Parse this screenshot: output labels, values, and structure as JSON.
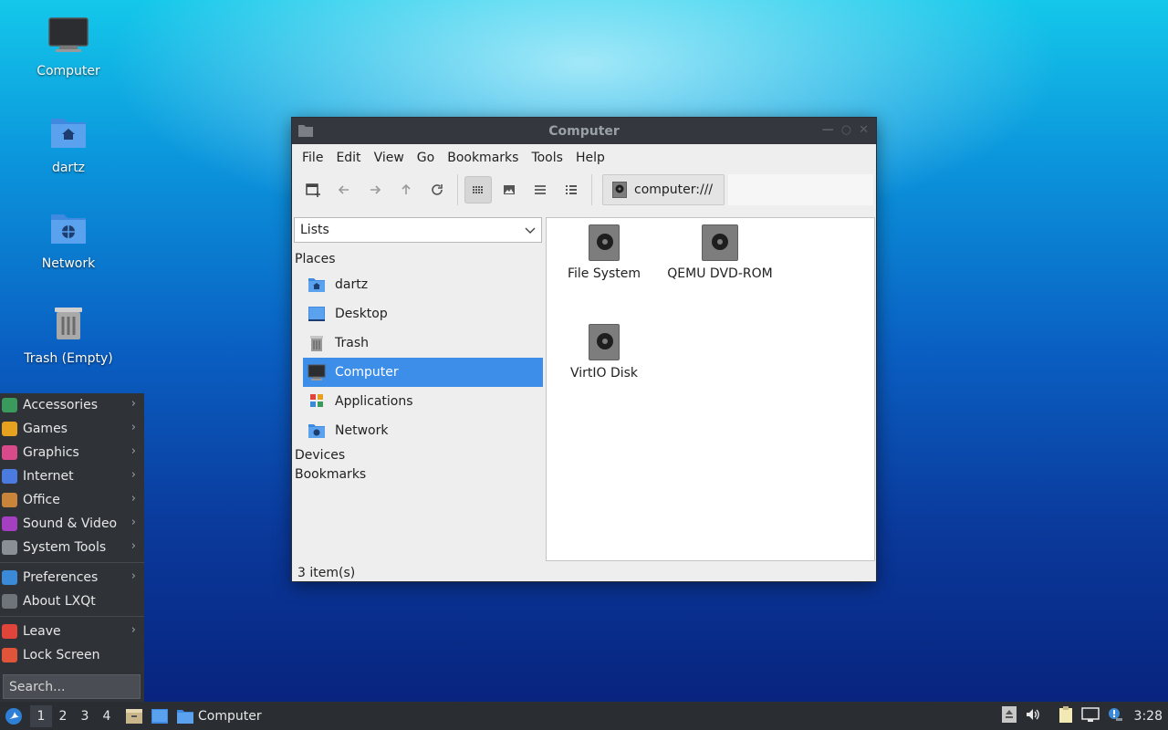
{
  "desktop": {
    "icons": [
      {
        "label": "Computer",
        "icon": "monitor-icon"
      },
      {
        "label": "dartz",
        "icon": "home-folder-icon"
      },
      {
        "label": "Network",
        "icon": "network-folder-icon"
      },
      {
        "label": "Trash (Empty)",
        "icon": "trash-icon"
      }
    ]
  },
  "window": {
    "title": "Computer",
    "menu": [
      "File",
      "Edit",
      "View",
      "Go",
      "Bookmarks",
      "Tools",
      "Help"
    ],
    "address": "computer:///",
    "side": {
      "combo_value": "Lists",
      "places_header": "Places",
      "places": [
        "dartz",
        "Desktop",
        "Trash",
        "Computer",
        "Applications",
        "Network"
      ],
      "selected": "Computer",
      "devices_header": "Devices",
      "bookmarks_header": "Bookmarks"
    },
    "items": [
      "File System",
      "QEMU DVD-ROM",
      "VirtIO Disk"
    ],
    "status": "3 item(s)"
  },
  "appmenu": {
    "groups": [
      [
        {
          "label": "Accessories",
          "color": "#3a9a5c",
          "submenu": true
        },
        {
          "label": "Games",
          "color": "#e6a11e",
          "submenu": true
        },
        {
          "label": "Graphics",
          "color": "#d94a8a",
          "submenu": true
        },
        {
          "label": "Internet",
          "color": "#4c7be0",
          "submenu": true
        },
        {
          "label": "Office",
          "color": "#c8843a",
          "submenu": true
        },
        {
          "label": "Sound & Video",
          "color": "#a43fc2",
          "submenu": true
        },
        {
          "label": "System Tools",
          "color": "#8a8f96",
          "submenu": true
        }
      ],
      [
        {
          "label": "Preferences",
          "color": "#3a8ad8",
          "submenu": true
        },
        {
          "label": "About LXQt",
          "color": "#6f747b",
          "submenu": false
        }
      ],
      [
        {
          "label": "Leave",
          "color": "#e0443a",
          "submenu": true
        },
        {
          "label": "Lock Screen",
          "color": "#e0553a",
          "submenu": false
        }
      ]
    ],
    "search_placeholder": "Search..."
  },
  "taskbar": {
    "desktops": [
      "1",
      "2",
      "3",
      "4"
    ],
    "active_desktop": "1",
    "task_label": "Computer",
    "clock": "3:28"
  },
  "colors": {
    "selection": "#3d8ee8",
    "panel": "#2a2d32"
  }
}
